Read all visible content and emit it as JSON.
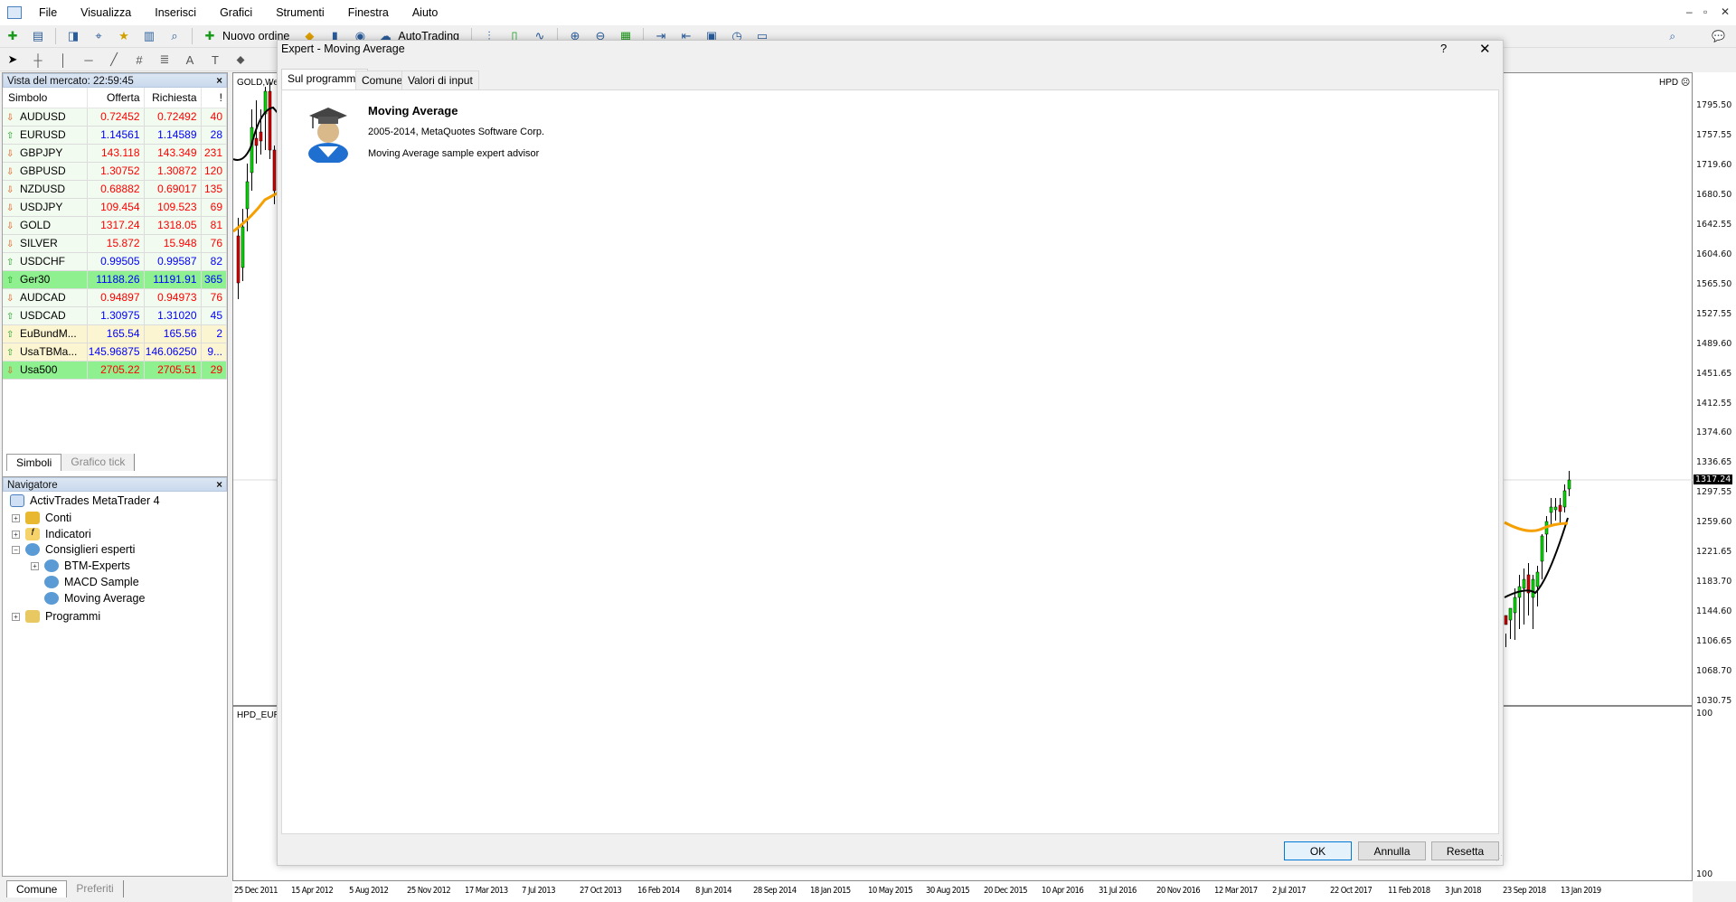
{
  "menu": {
    "items": [
      "File",
      "Visualizza",
      "Inserisci",
      "Grafici",
      "Strumenti",
      "Finestra",
      "Aiuto"
    ]
  },
  "toolbar": {
    "new_order": "Nuovo ordine",
    "autotrading": "AutoTrading"
  },
  "market_watch": {
    "title": "Vista del mercato: 22:59:45",
    "columns": [
      "Simbolo",
      "Offerta",
      "Richiesta",
      "!"
    ],
    "rows": [
      {
        "symbol": "AUDUSD",
        "bid": "0.72452",
        "ask": "0.72492",
        "spread": "40",
        "dir": "down"
      },
      {
        "symbol": "EURUSD",
        "bid": "1.14561",
        "ask": "1.14589",
        "spread": "28",
        "dir": "up"
      },
      {
        "symbol": "GBPJPY",
        "bid": "143.118",
        "ask": "143.349",
        "spread": "231",
        "dir": "down"
      },
      {
        "symbol": "GBPUSD",
        "bid": "1.30752",
        "ask": "1.30872",
        "spread": "120",
        "dir": "down"
      },
      {
        "symbol": "NZDUSD",
        "bid": "0.68882",
        "ask": "0.69017",
        "spread": "135",
        "dir": "down"
      },
      {
        "symbol": "USDJPY",
        "bid": "109.454",
        "ask": "109.523",
        "spread": "69",
        "dir": "down"
      },
      {
        "symbol": "GOLD",
        "bid": "1317.24",
        "ask": "1318.05",
        "spread": "81",
        "dir": "down"
      },
      {
        "symbol": "SILVER",
        "bid": "15.872",
        "ask": "15.948",
        "spread": "76",
        "dir": "down"
      },
      {
        "symbol": "USDCHF",
        "bid": "0.99505",
        "ask": "0.99587",
        "spread": "82",
        "dir": "up"
      },
      {
        "symbol": "Ger30",
        "bid": "11188.26",
        "ask": "11191.91",
        "spread": "365",
        "dir": "up",
        "bg": "#8ef08e"
      },
      {
        "symbol": "AUDCAD",
        "bid": "0.94897",
        "ask": "0.94973",
        "spread": "76",
        "dir": "down"
      },
      {
        "symbol": "USDCAD",
        "bid": "1.30975",
        "ask": "1.31020",
        "spread": "45",
        "dir": "up"
      },
      {
        "symbol": "EuBundM...",
        "bid": "165.54",
        "ask": "165.56",
        "spread": "2",
        "dir": "up",
        "bg": "#fbf5d2"
      },
      {
        "symbol": "UsaTBMa...",
        "bid": "145.96875",
        "ask": "146.06250",
        "spread": "9...",
        "dir": "up",
        "bg": "#fbf5d2"
      },
      {
        "symbol": "Usa500",
        "bid": "2705.22",
        "ask": "2705.51",
        "spread": "29",
        "dir": "down",
        "bg": "#8ef08e"
      }
    ],
    "tabs": [
      "Simboli",
      "Grafico tick"
    ]
  },
  "navigator": {
    "title": "Navigatore",
    "root": "ActivTrades MetaTrader 4",
    "items": [
      "Conti",
      "Indicatori",
      "Consiglieri esperti",
      "BTM-Experts",
      "MACD Sample",
      "Moving Average",
      "Programmi"
    ],
    "tabs": [
      "Comune",
      "Preferiti"
    ]
  },
  "chart": {
    "title": "GOLD,We",
    "indicator_title": "HPD_EUR",
    "indicator_label": "HPD",
    "current_price": "1317.24",
    "price_ticks": [
      "1795.50",
      "1757.55",
      "1719.60",
      "1680.50",
      "1642.55",
      "1604.60",
      "1565.50",
      "1527.55",
      "1489.60",
      "1451.65",
      "1412.55",
      "1374.60",
      "1336.65",
      "1297.55",
      "1259.60",
      "1221.65",
      "1183.70",
      "1144.60",
      "1106.65",
      "1068.70",
      "1030.75"
    ],
    "indicator_ticks": [
      "100",
      "100"
    ],
    "time_ticks": [
      "25 Dec 2011",
      "15 Apr 2012",
      "5 Aug 2012",
      "25 Nov 2012",
      "17 Mar 2013",
      "7 Jul 2013",
      "27 Oct 2013",
      "16 Feb 2014",
      "8 Jun 2014",
      "28 Sep 2014",
      "18 Jan 2015",
      "10 May 2015",
      "30 Aug 2015",
      "20 Dec 2015",
      "10 Apr 2016",
      "31 Jul 2016",
      "20 Nov 2016",
      "12 Mar 2017",
      "2 Jul 2017",
      "22 Oct 2017",
      "11 Feb 2018",
      "3 Jun 2018",
      "23 Sep 2018",
      "13 Jan 2019"
    ],
    "colors": {
      "bull": "#00e000",
      "bear": "#e00000",
      "ma_fast": "#000000",
      "ma_slow": "#f5a000"
    }
  },
  "dialog": {
    "title": "Expert - Moving Average",
    "help": "?",
    "close": "✕",
    "tabs": [
      "Sul programma",
      "Comune",
      "Valori di input"
    ],
    "name": "Moving Average",
    "copyright": "2005-2014, MetaQuotes Software Corp.",
    "description": "Moving Average sample expert advisor",
    "ok": "OK",
    "cancel": "Annulla",
    "reset": "Resetta"
  }
}
